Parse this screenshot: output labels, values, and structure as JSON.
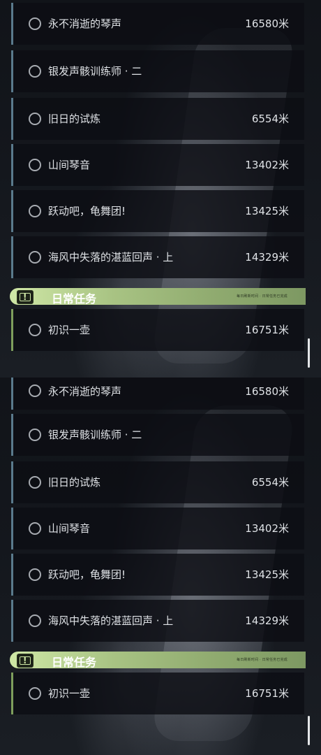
{
  "panels": [
    {
      "quests": [
        {
          "title": "永不消逝的琴声",
          "distance": "16580米"
        },
        {
          "title": "银发声骸训练师 · 二",
          "distance": ""
        },
        {
          "title": "旧日的试炼",
          "distance": "6554米"
        },
        {
          "title": "山间琴音",
          "distance": "13402米"
        },
        {
          "title": "跃动吧，龟舞团!",
          "distance": "13425米"
        },
        {
          "title": "海风中失落的湛蓝回声 · 上",
          "distance": "14329米"
        }
      ],
      "section": {
        "label": "日常任务",
        "note": "每日刷新时间 · 日常任务已完成"
      },
      "daily": [
        {
          "title": "初识一壶",
          "distance": "16751米"
        }
      ]
    },
    {
      "quests": [
        {
          "title": "永不消逝的琴声",
          "distance": "16580米"
        },
        {
          "title": "银发声骸训练师 · 二",
          "distance": ""
        },
        {
          "title": "旧日的试炼",
          "distance": "6554米"
        },
        {
          "title": "山间琴音",
          "distance": "13402米"
        },
        {
          "title": "跃动吧，龟舞团!",
          "distance": "13425米"
        },
        {
          "title": "海风中失落的湛蓝回声 · 上",
          "distance": "14329米"
        }
      ],
      "section": {
        "label": "日常任务",
        "note": "每日刷新时间 · 日常任务已完成"
      },
      "daily": [
        {
          "title": "初识一壶",
          "distance": "16751米"
        }
      ]
    }
  ],
  "colors": {
    "accent": "#a8c383",
    "quest_bar": "#5a7a8c",
    "daily_bar": "#7e9e5c"
  },
  "icons": {
    "radio": "radio-circle-icon",
    "alert": "alert-icon"
  }
}
